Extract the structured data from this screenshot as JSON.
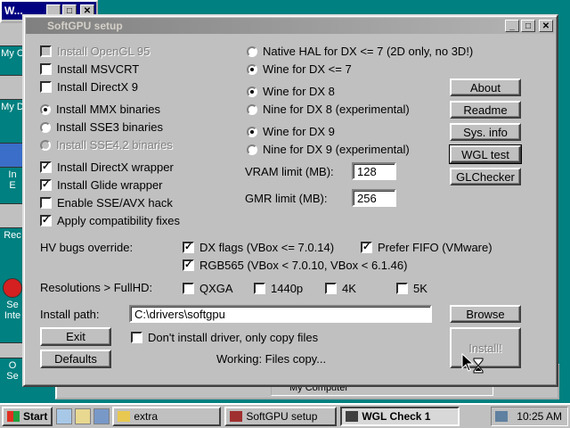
{
  "mini_window": {
    "title": "W..."
  },
  "desktop": {
    "icons": [
      {
        "label": "My C"
      },
      {
        "label": "My D"
      },
      {
        "label": "In\nE"
      },
      {
        "label": "Rec"
      },
      {
        "label": "Se\nInte"
      },
      {
        "label": "O\nSe"
      }
    ]
  },
  "background_window": {
    "status": "My Computer"
  },
  "window": {
    "title": "SoftGPU setup",
    "left_options": [
      {
        "label": "Install OpenGL 95",
        "type": "checkbox",
        "checked": false,
        "disabled": true
      },
      {
        "label": "Install MSVCRT",
        "type": "checkbox",
        "checked": false,
        "disabled": false
      },
      {
        "label": "Install DirectX 9",
        "type": "checkbox",
        "checked": false,
        "disabled": false
      },
      {
        "label": "Install MMX binaries",
        "type": "radio",
        "checked": true,
        "disabled": false
      },
      {
        "label": "Install SSE3 binaries",
        "type": "radio",
        "checked": false,
        "disabled": false
      },
      {
        "label": "Install SSE4.2 binaries",
        "type": "radio",
        "checked": false,
        "disabled": true
      },
      {
        "label": "Install DirectX wrapper",
        "type": "checkbox",
        "checked": true,
        "disabled": false
      },
      {
        "label": "Install Glide wrapper",
        "type": "checkbox",
        "checked": true,
        "disabled": false
      },
      {
        "label": "Enable SSE/AVX hack",
        "type": "checkbox",
        "checked": false,
        "disabled": false
      },
      {
        "label": "Apply compatibility fixes",
        "type": "checkbox",
        "checked": true,
        "disabled": false
      }
    ],
    "right_options": [
      {
        "label": "Native HAL for DX <= 7 (2D only, no 3D!)",
        "checked": false
      },
      {
        "label": "Wine for DX <= 7",
        "checked": true
      },
      {
        "label": "Wine for DX 8",
        "checked": true
      },
      {
        "label": "Nine for DX 8 (experimental)",
        "checked": false
      },
      {
        "label": "Wine for DX 9",
        "checked": true
      },
      {
        "label": "Nine for DX 9 (experimental)",
        "checked": false
      }
    ],
    "vram_label": "VRAM limit (MB):",
    "vram_value": "128",
    "gmr_label": "GMR limit (MB):",
    "gmr_value": "256",
    "side_buttons": [
      "About",
      "Readme",
      "Sys. info",
      "WGL test",
      "GLChecker"
    ],
    "hv_label": "HV bugs override:",
    "hv_options": [
      {
        "label": "DX flags (VBox <= 7.0.14)",
        "checked": true
      },
      {
        "label": "Prefer FIFO (VMware)",
        "checked": true
      },
      {
        "label": "RGB565 (VBox < 7.0.10, VBox < 6.1.46)",
        "checked": true
      }
    ],
    "res_label": "Resolutions > FullHD:",
    "res_options": [
      {
        "label": "QXGA",
        "checked": false
      },
      {
        "label": "1440p",
        "checked": false
      },
      {
        "label": "4K",
        "checked": false
      },
      {
        "label": "5K",
        "checked": false
      }
    ],
    "path_label": "Install path:",
    "path_value": "C:\\drivers\\softgpu",
    "browse_label": "Browse",
    "exit_label": "Exit",
    "defaults_label": "Defaults",
    "copy_only_label": "Don't install driver, only copy files",
    "copy_only_checked": false,
    "install_label": "Install!",
    "status": "Working: Files copy..."
  },
  "taskbar": {
    "start_label": "Start",
    "items": [
      {
        "label": "extra",
        "active": false
      },
      {
        "label": "SoftGPU setup",
        "active": false
      },
      {
        "label": "WGL Check 1",
        "active": true
      }
    ],
    "clock": "10:25 AM"
  }
}
